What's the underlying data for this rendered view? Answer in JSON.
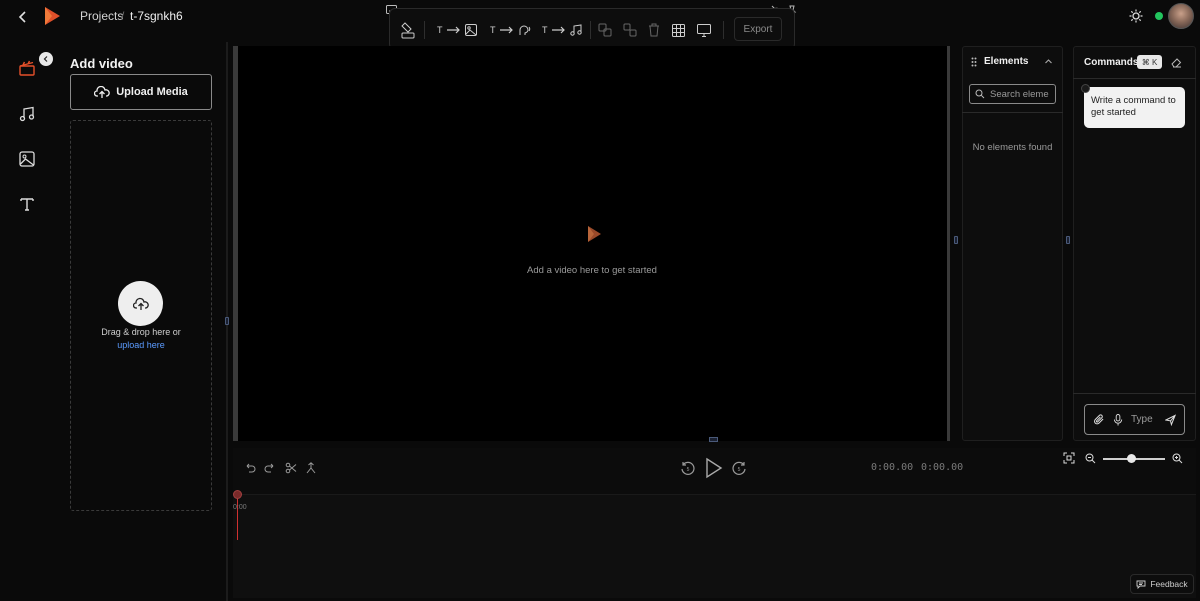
{
  "breadcrumb": {
    "root": "Projects",
    "separator": "/",
    "current": "t-7sgnkh6"
  },
  "toolbar": {
    "text_to_image_t": "T",
    "text_to_speech_t": "T",
    "text_to_music_t": "T",
    "export_label": "Export"
  },
  "media_panel": {
    "title": "Add video",
    "upload_label": "Upload Media",
    "drop_text": "Drag & drop here or",
    "drop_link": "upload here"
  },
  "preview": {
    "empty_text": "Add a video here to get started"
  },
  "elements_panel": {
    "title": "Elements",
    "search_placeholder": "Search eleme",
    "empty_text": "No elements found"
  },
  "commands_panel": {
    "title": "Commands",
    "shortcut": "⌘ K",
    "welcome": "Write a command to get started",
    "input_placeholder": "Type"
  },
  "timeline": {
    "current_time": "0:00.00",
    "total_time": "0:00.00",
    "ruler_start": "0:00",
    "zoom_level": 0.45
  },
  "status": {
    "online_color": "#22c55e"
  },
  "accent": {
    "link": "#5b9bff",
    "playhead": "#d03030"
  },
  "feedback_label": "Feedback",
  "icons": [
    "back-icon",
    "app-logo",
    "keyboard-icon",
    "brush-icon",
    "arrow-right-icon",
    "image-icon",
    "speech-icon",
    "music-icon",
    "group-icon",
    "ungroup-icon",
    "trash-icon",
    "grid-icon",
    "monitor-icon",
    "eye-off-icon",
    "pin-icon",
    "sun-icon",
    "clapper-icon",
    "music-note-icon",
    "image-icon",
    "text-icon",
    "upload-icon",
    "search-icon",
    "grip-icon",
    "chevron-up-icon",
    "eraser-icon",
    "paperclip-icon",
    "mic-icon",
    "send-icon",
    "undo-icon",
    "redo-icon",
    "scissors-icon",
    "split-icon",
    "rewind-icon",
    "play-icon",
    "forward-icon",
    "fit-icon",
    "zoom-out-icon",
    "zoom-in-icon",
    "chat-icon"
  ]
}
